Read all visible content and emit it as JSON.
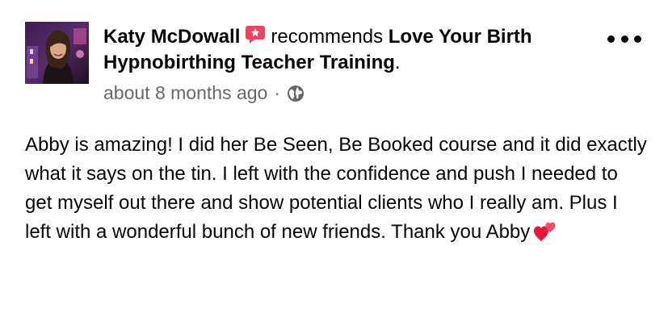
{
  "post": {
    "author": "Katy McDowall",
    "verb": "recommends",
    "page_name": "Love Your Birth Hypnobirthing Teacher Training",
    "page_suffix": ".",
    "timestamp": "about 8 months ago",
    "separator": "·",
    "privacy_icon": "globe-icon",
    "recommend_icon": "recommend-badge-icon",
    "more_icon": "more-options-icon",
    "body": "Abby is amazing! I did her Be Seen, Be Booked course and it did exactly what it says on the tin. I left with the confidence and push I needed to get myself out there and show potential clients who I really am. Plus I left with a wonderful bunch of new friends. Thank you Abby",
    "emoji_icon": "two-hearts-icon"
  },
  "colors": {
    "text": "#050505",
    "secondary_text": "#65676b",
    "recommend_badge": "#f3425f"
  }
}
